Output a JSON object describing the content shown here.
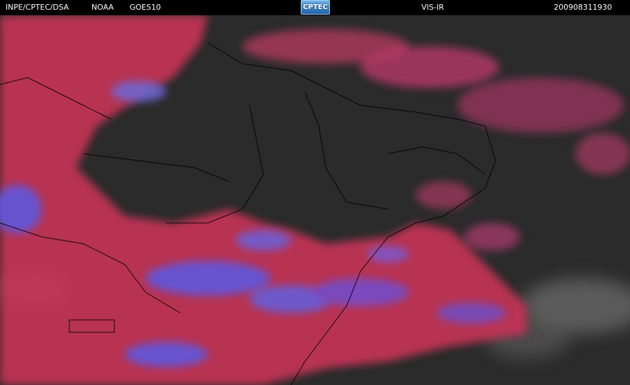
{
  "header": {
    "agency": "INPE/CPTEC/DSA",
    "partner": "NOAA",
    "satellite": "GOES10",
    "logo_text": "CPTEC",
    "product": "VIS-IR",
    "timestamp": "200908311930"
  },
  "colors": {
    "background": "#000000",
    "surface": "#2b2b2b",
    "cold_cloud": "#d0345a",
    "very_cold_cloud": "#5a5ae6",
    "warm_cloud": "#cfcfcf",
    "borders": "#000000"
  },
  "icons": [
    "cptec-logo"
  ]
}
